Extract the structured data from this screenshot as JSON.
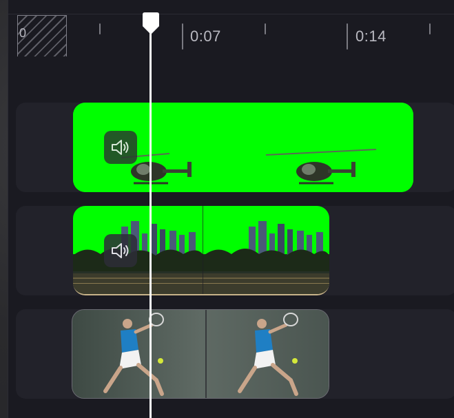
{
  "ruler": {
    "start_label": "0",
    "labels": [
      {
        "text": "0:07"
      },
      {
        "text": "0:14"
      }
    ]
  },
  "tracks": [
    {
      "name": "helicopter-clip",
      "background_color": "#00ff00",
      "audio_icon": "speaker-icon"
    },
    {
      "name": "city-skyline-clip",
      "background_color": "#00ff00",
      "audio_icon": "speaker-icon"
    },
    {
      "name": "tennis-player-clip",
      "background_color": "#4a544e"
    }
  ],
  "playhead": {
    "color": "#ffffff"
  },
  "colors": {
    "panel_bg": "#1a1a21",
    "track_bg": "#22222a",
    "chroma_green": "#00ff00",
    "tick_color": "#7a7a82",
    "label_color": "#b9b9c1"
  }
}
